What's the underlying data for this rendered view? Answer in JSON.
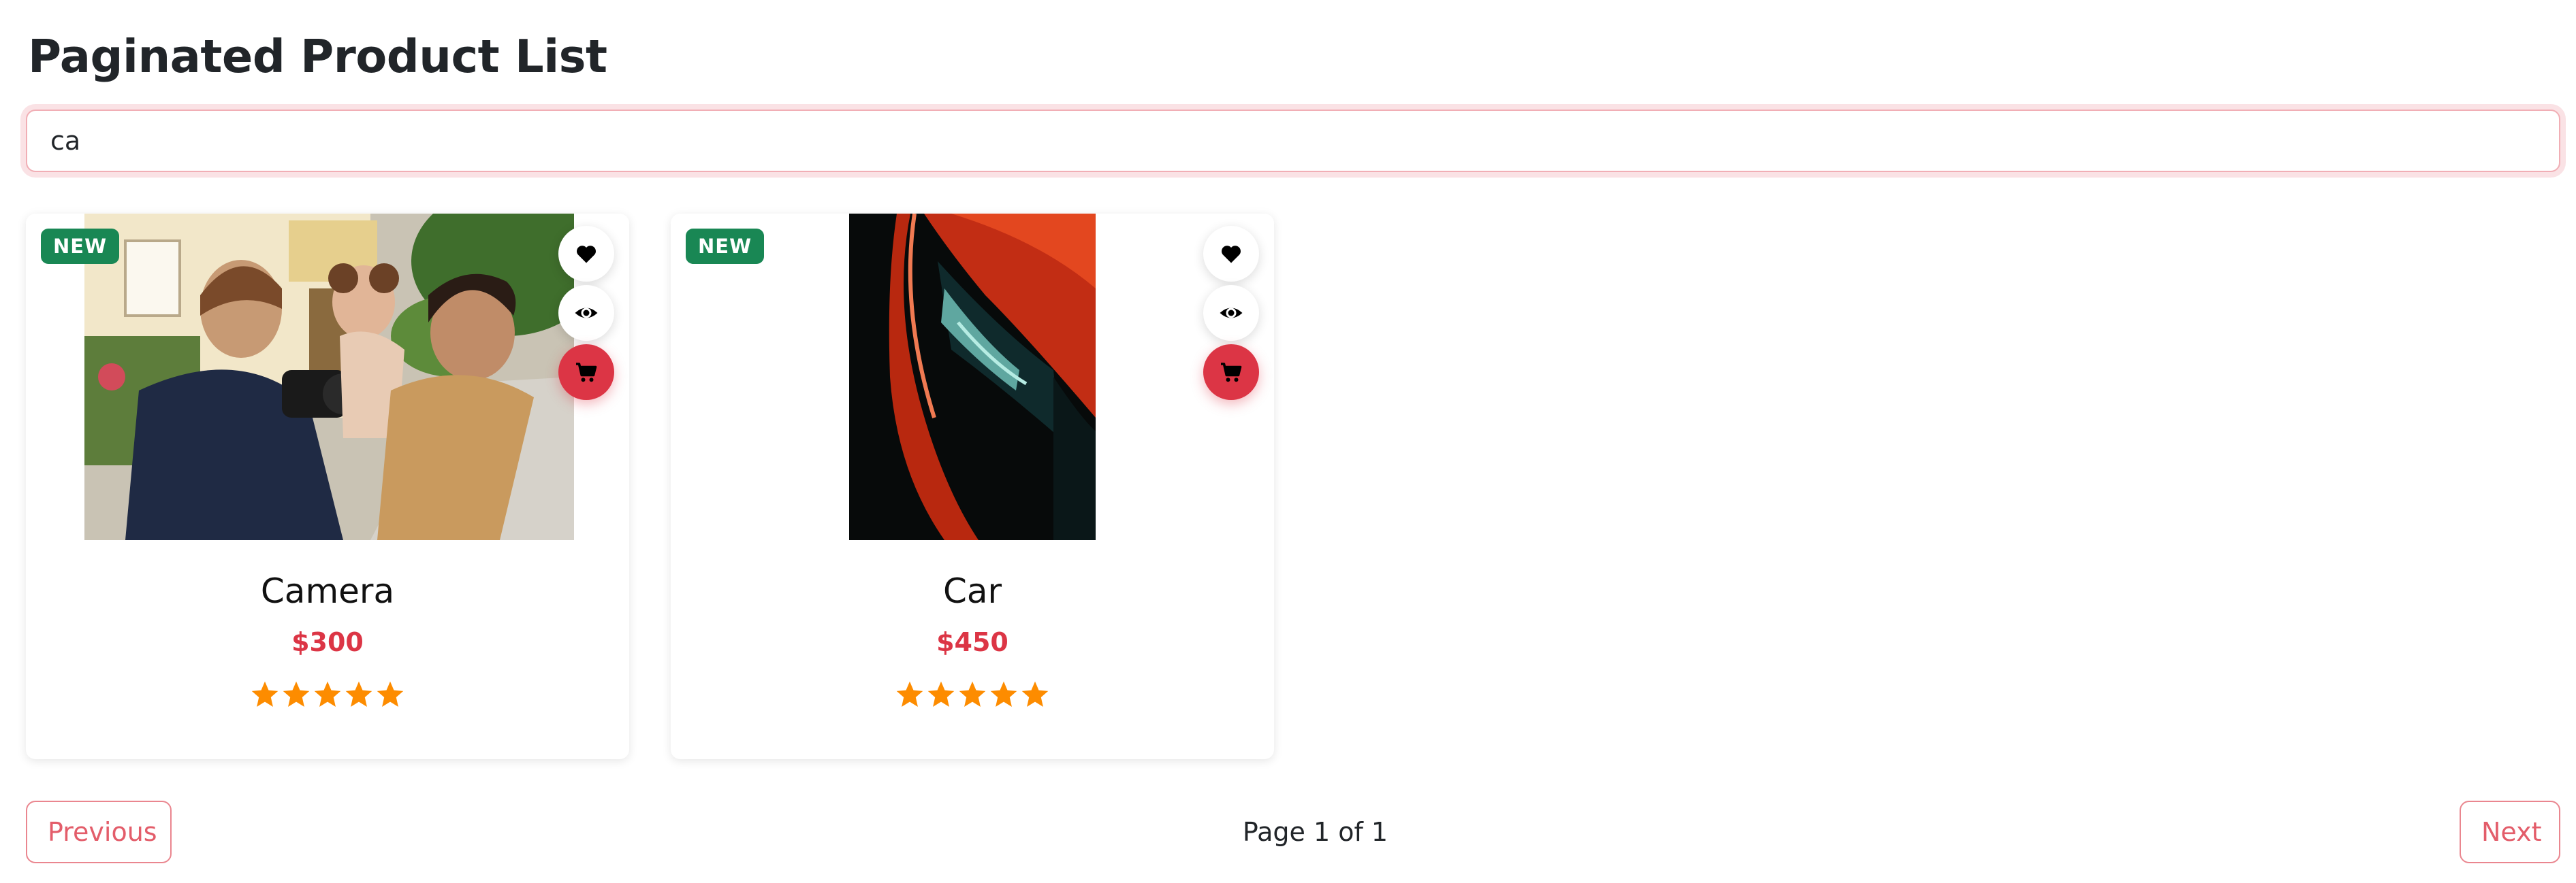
{
  "page": {
    "title": "Paginated Product List"
  },
  "search": {
    "value": "ca",
    "placeholder": ""
  },
  "products": [
    {
      "name": "Camera",
      "price": "$300",
      "badge": "NEW",
      "rating": 5,
      "rating_max": 5,
      "image": "photo-family-with-camera"
    },
    {
      "name": "Car",
      "price": "$450",
      "badge": "NEW",
      "rating": 5,
      "rating_max": 5,
      "image": "photo-red-car-closeup"
    }
  ],
  "pagination": {
    "previous_label": "Previous",
    "next_label": "Next",
    "indicator": "Page 1 of 1"
  },
  "icons": {
    "wishlist": "heart-icon",
    "quick_view": "eye-icon",
    "add_to_cart": "cart-icon",
    "rating": "star-icon"
  },
  "colors": {
    "accent": "#dc3545",
    "badge": "#198754",
    "star": "#fd8c00",
    "pagination_border": "#ea868f"
  }
}
